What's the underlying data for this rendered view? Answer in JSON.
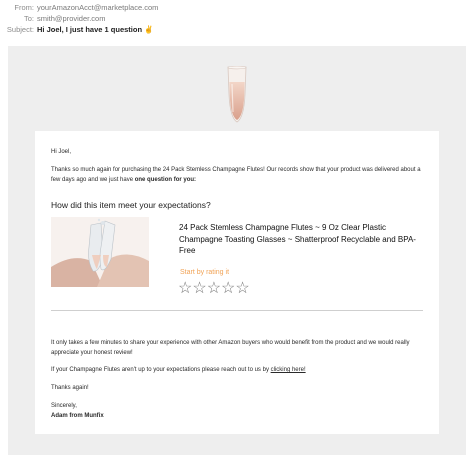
{
  "header": {
    "from_label": "From:",
    "from_value": "yourAmazonAcct@marketplace.com",
    "to_label": "To:",
    "to_value": "smith@provider.com",
    "subject_label": "Subject:",
    "subject_value": "Hi Joel, I just have 1 question ✌"
  },
  "email": {
    "greeting": "Hi Joel,",
    "intro": "Thanks so much again for purchasing the 24 Pack Stemless Champagne Flutes! Our records show that your product was delivered about a few days ago and we just have ",
    "intro_bold": "one question for you:",
    "question": "How did this item meet your expectations?",
    "product_title": "24 Pack Stemless Champagne Flutes ~ 9 Oz Clear Plastic Champagne Toasting Glasses ~ Shatterproof Recyclable and BPA-Free",
    "rate_label": "Start by rating it",
    "stars": [
      "☆",
      "☆",
      "☆",
      "☆",
      "☆"
    ],
    "para2": "It only takes a few minutes to share your experience with other Amazon buyers who would benefit from the product and we would really appreciate your honest review!",
    "para3_prefix": "If your Champagne Flutes aren't up to your expectations please reach out to us by ",
    "para3_link": "clicking here!",
    "thanks": "Thanks again!",
    "signoff": "Sincerely,",
    "signature": "Adam from Munfix"
  },
  "colors": {
    "accent_orange": "#f1a356",
    "page_bg": "#eeeeee",
    "card_bg": "#ffffff"
  }
}
